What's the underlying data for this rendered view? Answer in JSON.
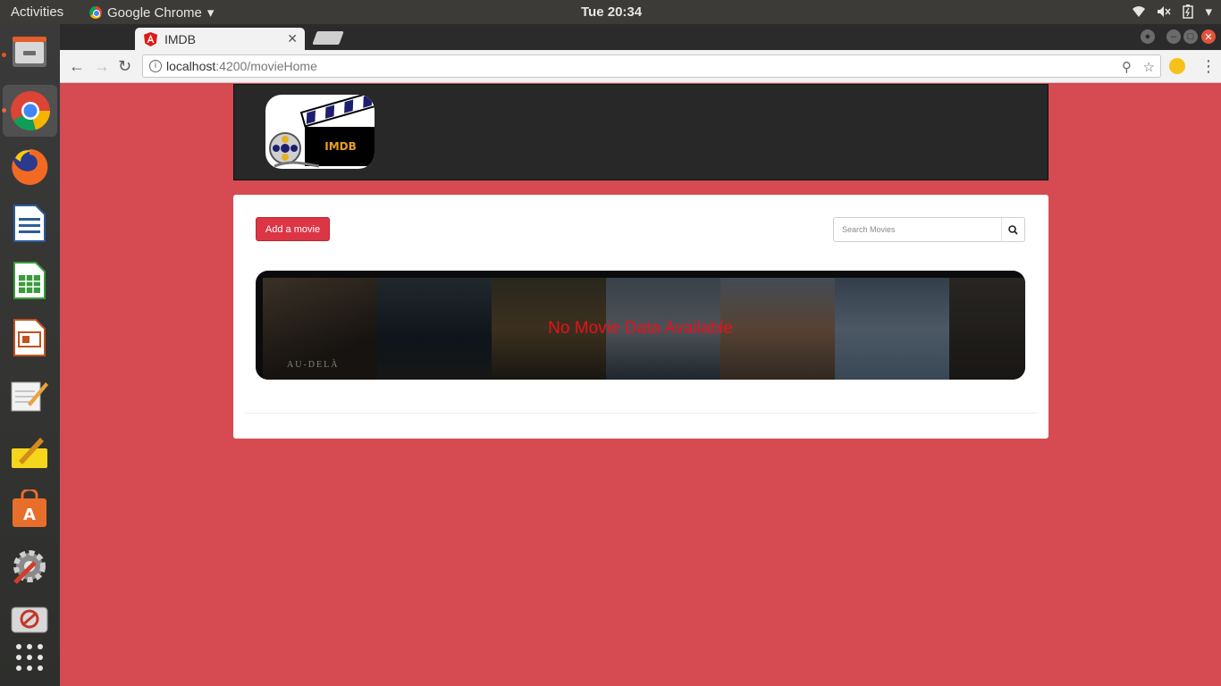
{
  "os": {
    "activities": "Activities",
    "app_name": "Google Chrome",
    "clock": "Tue 20:34"
  },
  "dock": {
    "items": [
      "Files",
      "Google Chrome",
      "Firefox",
      "LibreOffice Writer",
      "LibreOffice Calc",
      "LibreOffice Impress",
      "Text Editor",
      "Notes",
      "Ubuntu Software",
      "System Settings",
      "Remote Desktop",
      "Show Applications"
    ]
  },
  "browser": {
    "tab_title": "IMDB",
    "url_host": "localhost",
    "url_path": ":4200/movieHome"
  },
  "page": {
    "logo_text": "IMDB",
    "add_movie_label": "Add a movie",
    "search_placeholder": "Search Movies",
    "empty_message": "No Movie Data Available",
    "poster_caption": "AU-DELÀ"
  },
  "colors": {
    "page_background": "#d64a52",
    "header_background": "#282828",
    "button": "#dc3545",
    "empty_message": "#e8101a"
  }
}
